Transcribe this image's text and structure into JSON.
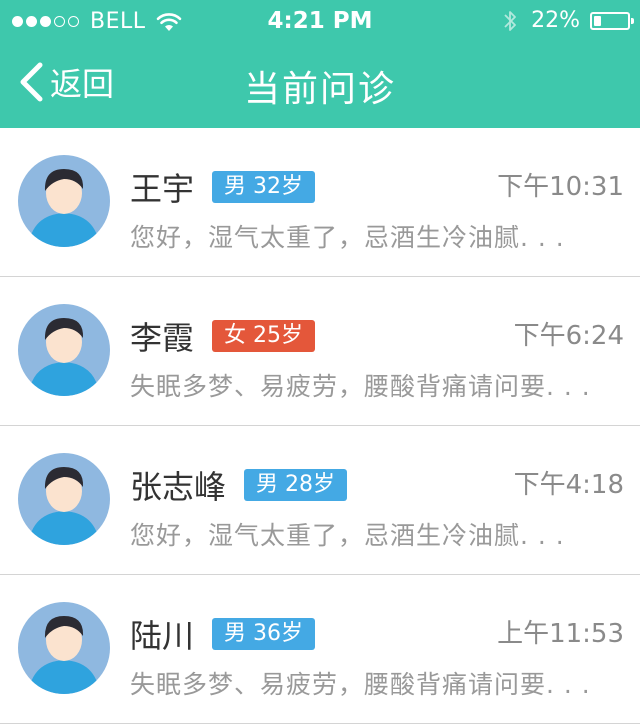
{
  "status_bar": {
    "carrier": "BELL",
    "time": "4:21 PM",
    "battery": "22%",
    "battery_level": 0.22,
    "signal_dots_full": 3,
    "signal_dots_total": 5
  },
  "nav": {
    "back_label": "返回",
    "title": "当前问诊"
  },
  "colors": {
    "header_bg": "#3ec8ac",
    "badge_male": "#44a9e4",
    "badge_female": "#e4573a"
  },
  "consultations": [
    {
      "name": "王宇",
      "badge": "男 32岁",
      "gender": "male",
      "time": "下午10:31",
      "message": "您好，湿气太重了，忌酒生冷油腻. . ."
    },
    {
      "name": "李霞",
      "badge": "女 25岁",
      "gender": "female",
      "time": "下午6:24",
      "message": "失眠多梦、易疲劳，腰酸背痛请问要. . ."
    },
    {
      "name": "张志峰",
      "badge": "男 28岁",
      "gender": "male",
      "time": "下午4:18",
      "message": "您好，湿气太重了，忌酒生冷油腻. . ."
    },
    {
      "name": "陆川",
      "badge": "男 36岁",
      "gender": "male",
      "time": "上午11:53",
      "message": "失眠多梦、易疲劳，腰酸背痛请问要. . ."
    }
  ]
}
